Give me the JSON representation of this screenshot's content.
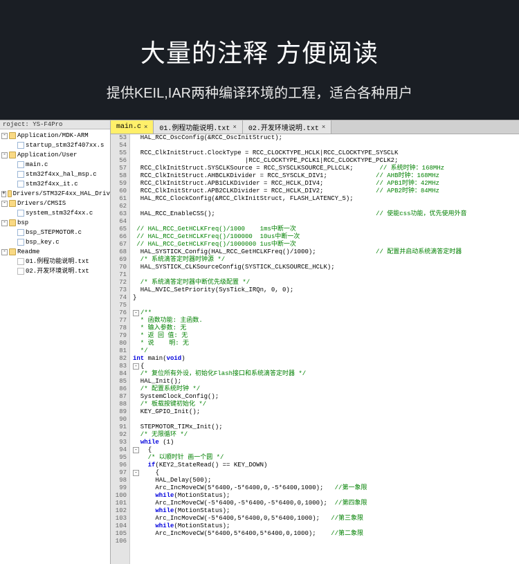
{
  "hero": {
    "title": "大量的注释 方便阅读",
    "subtitle": "提供KEIL,IAR两种编译环境的工程，适合各种用户"
  },
  "project_header": "roject: YS-F4Pro",
  "tree": [
    {
      "d": 0,
      "exp": "-",
      "icon": "folder",
      "label": "Application/MDK-ARM"
    },
    {
      "d": 1,
      "exp": "",
      "icon": "file",
      "label": "startup_stm32f407xx.s"
    },
    {
      "d": 0,
      "exp": "-",
      "icon": "folder",
      "label": "Application/User"
    },
    {
      "d": 1,
      "exp": "",
      "icon": "file",
      "label": "main.c"
    },
    {
      "d": 1,
      "exp": "",
      "icon": "file",
      "label": "stm32f4xx_hal_msp.c"
    },
    {
      "d": 1,
      "exp": "",
      "icon": "file",
      "label": "stm32f4xx_it.c"
    },
    {
      "d": 0,
      "exp": "+",
      "icon": "folder",
      "label": "Drivers/STM32F4xx_HAL_Driv"
    },
    {
      "d": 0,
      "exp": "-",
      "icon": "folder",
      "label": "Drivers/CMSIS"
    },
    {
      "d": 1,
      "exp": "",
      "icon": "file",
      "label": "system_stm32f4xx.c"
    },
    {
      "d": 0,
      "exp": "-",
      "icon": "folder",
      "label": "bsp"
    },
    {
      "d": 1,
      "exp": "",
      "icon": "file",
      "label": "bsp_STEPMOTOR.c"
    },
    {
      "d": 1,
      "exp": "",
      "icon": "file",
      "label": "bsp_key.c"
    },
    {
      "d": 0,
      "exp": "-",
      "icon": "folder",
      "label": "Readme"
    },
    {
      "d": 1,
      "exp": "",
      "icon": "txt",
      "label": "01.例程功能说明.txt"
    },
    {
      "d": 1,
      "exp": "",
      "icon": "txt",
      "label": "02.开发环境说明.txt"
    }
  ],
  "tabs": [
    {
      "label": "main.c",
      "active": true
    },
    {
      "label": "01.例程功能说明.txt",
      "active": false
    },
    {
      "label": "02.开发环境说明.txt",
      "active": false
    }
  ],
  "first_line": 53,
  "code": [
    {
      "t": "  HAL_RCC_OscConfig(&RCC_OscInitStruct);",
      "c": ""
    },
    {
      "t": "",
      "c": ""
    },
    {
      "t": "  RCC_ClkInitStruct.ClockType = RCC_CLOCKTYPE_HCLK|RCC_CLOCKTYPE_SYSCLK",
      "c": ""
    },
    {
      "t": "                              |RCC_CLOCKTYPE_PCLK1|RCC_CLOCKTYPE_PCLK2;",
      "c": ""
    },
    {
      "t": "  RCC_ClkInitStruct.SYSCLKSource = RCC_SYSCLKSOURCE_PLLCLK;",
      "c": "      // 系统时钟：168MHz"
    },
    {
      "t": "  RCC_ClkInitStruct.AHBCLKDivider = RCC_SYSCLK_DIV1;",
      "c": "            // AHB时钟：168MHz"
    },
    {
      "t": "  RCC_ClkInitStruct.APB1CLKDivider = RCC_HCLK_DIV4;",
      "c": "             // APB1时钟：42MHz"
    },
    {
      "t": "  RCC_ClkInitStruct.APB2CLKDivider = RCC_HCLK_DIV2;",
      "c": "             // APB2时钟：84MHz"
    },
    {
      "t": "  HAL_RCC_ClockConfig(&RCC_ClkInitStruct, FLASH_LATENCY_5);",
      "c": ""
    },
    {
      "t": "",
      "c": ""
    },
    {
      "t": "  HAL_RCC_EnableCSS();",
      "c": "                                          // 使能css功能，优先使用外音"
    },
    {
      "t": "",
      "c": ""
    },
    {
      "t": "",
      "c": " // HAL_RCC_GetHCLKFreq()/1000    1ms中断一次",
      "full_cm": true
    },
    {
      "t": "",
      "c": " // HAL_RCC_GetHCLKFreq()/100000  10us中断一次",
      "full_cm": true
    },
    {
      "t": "",
      "c": " // HAL_RCC_GetHCLKFreq()/1000000 1us中断一次",
      "full_cm": true
    },
    {
      "t": "  HAL_SYSTICK_Config(HAL_RCC_GetHCLKFreq()/1000);",
      "c": "               // 配置并启动系统滴答定时器"
    },
    {
      "t": "",
      "c": "  /* 系统滴答定时器时钟源 */",
      "full_cm": true
    },
    {
      "t": "  HAL_SYSTICK_CLKSourceConfig(SYSTICK_CLKSOURCE_HCLK);",
      "c": ""
    },
    {
      "t": "",
      "c": ""
    },
    {
      "t": "",
      "c": "  /* 系统滴答定时器中断优先级配置 */",
      "full_cm": true
    },
    {
      "t": "  HAL_NVIC_SetPriority(SysTick_IRQn, 0, 0);",
      "c": ""
    },
    {
      "t": "}",
      "c": ""
    },
    {
      "t": "",
      "c": ""
    },
    {
      "t": "",
      "c": "/**",
      "full_cm": true,
      "fold": true
    },
    {
      "t": "",
      "c": "  * 函数功能: 主函数.",
      "full_cm": true
    },
    {
      "t": "",
      "c": "  * 输入参数: 无",
      "full_cm": true
    },
    {
      "t": "",
      "c": "  * 返 回 值: 无",
      "full_cm": true
    },
    {
      "t": "",
      "c": "  * 说    明: 无",
      "full_cm": true
    },
    {
      "t": "",
      "c": "  */",
      "full_cm": true
    },
    {
      "t": "int main(void)",
      "c": "",
      "kw": true
    },
    {
      "t": "{",
      "c": "",
      "fold": true
    },
    {
      "t": "",
      "c": "  /* 复位所有外设，初始化Flash接口和系统滴答定时器 */",
      "full_cm": true
    },
    {
      "t": "  HAL_Init();",
      "c": ""
    },
    {
      "t": "",
      "c": "  /* 配置系统时钟 */",
      "full_cm": true
    },
    {
      "t": "  SystemClock_Config();",
      "c": ""
    },
    {
      "t": "",
      "c": "  /* 板载按键初始化 */",
      "full_cm": true
    },
    {
      "t": "  KEY_GPIO_Init();",
      "c": ""
    },
    {
      "t": "",
      "c": ""
    },
    {
      "t": "  STEPMOTOR_TIMx_Init();",
      "c": ""
    },
    {
      "t": "",
      "c": "  /* 无限循环 */",
      "full_cm": true
    },
    {
      "t": "  while (1)",
      "c": "",
      "kw": true
    },
    {
      "t": "  {",
      "c": "",
      "fold": true
    },
    {
      "t": "",
      "c": "    /* 以顺时针 画一个圆 */",
      "full_cm": true
    },
    {
      "t": "    if(KEY2_StateRead() == KEY_DOWN)",
      "c": "",
      "kw": true
    },
    {
      "t": "    {",
      "c": "",
      "fold": true
    },
    {
      "t": "      HAL_Delay(500);",
      "c": ""
    },
    {
      "t": "      Arc_IncMoveCW(5*6400,-5*6400,0,-5*6400,1000);",
      "c": "  //第一象限"
    },
    {
      "t": "      while(MotionStatus);",
      "c": "",
      "kw": true
    },
    {
      "t": "      Arc_IncMoveCW(-5*6400,-5*6400,-5*6400,0,1000);",
      "c": " //第四象限"
    },
    {
      "t": "      while(MotionStatus);",
      "c": "",
      "kw": true
    },
    {
      "t": "      Arc_IncMoveCW(-5*6400,5*6400,0,5*6400,1000);",
      "c": "  //第三象限"
    },
    {
      "t": "      while(MotionStatus);",
      "c": "",
      "kw": true
    },
    {
      "t": "      Arc_IncMoveCW(5*6400,5*6400,5*6400,0,1000);",
      "c": "   //第二象限"
    },
    {
      "t": "",
      "c": ""
    }
  ]
}
